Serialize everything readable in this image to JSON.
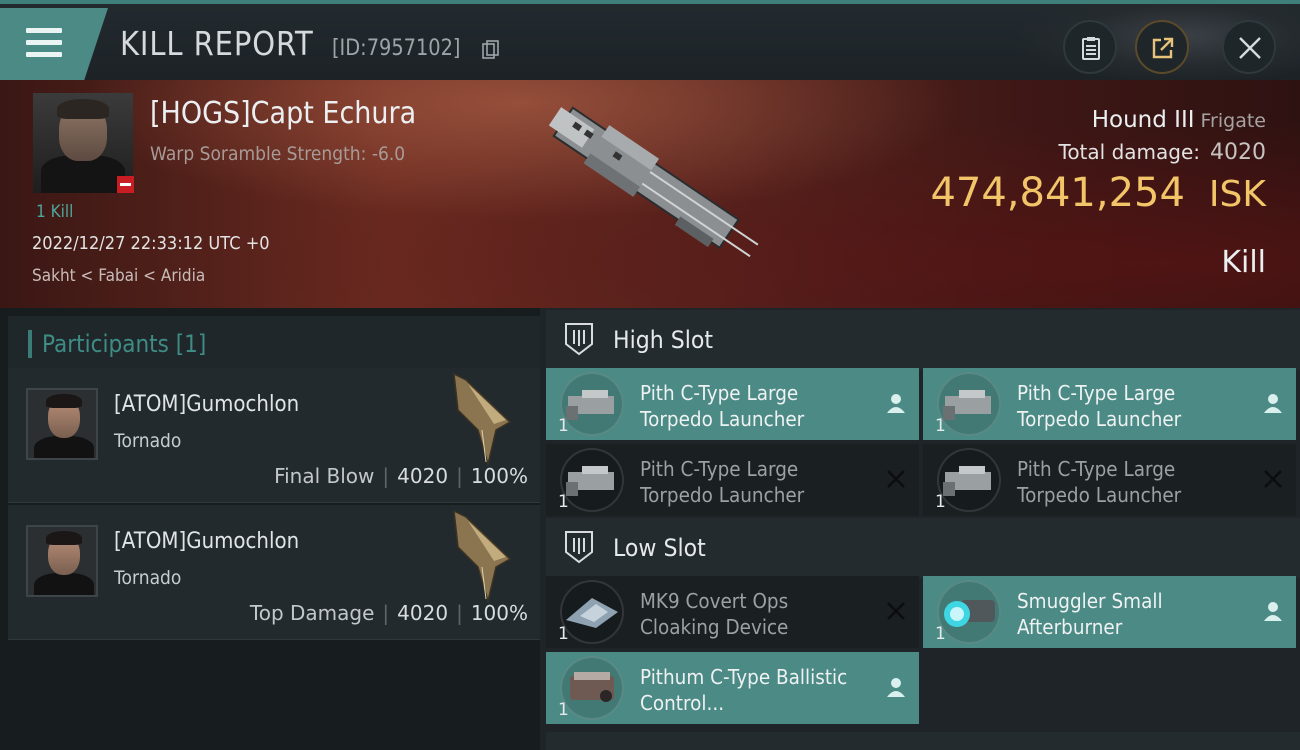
{
  "header": {
    "title": "KILL REPORT",
    "kill_id": "[ID:7957102]"
  },
  "victim": {
    "name": "[HOGS]Capt Echura",
    "subtitle": "Warp Soramble Strength: -6.0",
    "kill_count": "1 Kill",
    "date": "2022/12/27 22:33:12 UTC +0",
    "location": "Sakht < Fabai < Aridia",
    "ship_name": "Hound III",
    "ship_class": "Frigate",
    "total_damage_label": "Total damage:",
    "total_damage": "4020",
    "isk_value": "474,841,254",
    "isk_unit": "ISK",
    "result": "Kill"
  },
  "participants": {
    "heading": "Participants [1]",
    "rows": [
      {
        "name": "[ATOM]Gumochlon",
        "ship": "Tornado",
        "role": "Final Blow",
        "damage": "4020",
        "percent": "100%"
      },
      {
        "name": "[ATOM]Gumochlon",
        "ship": "Tornado",
        "role": "Top Damage",
        "damage": "4020",
        "percent": "100%"
      }
    ]
  },
  "slots": {
    "high": {
      "label": "High Slot",
      "modules": [
        {
          "qty": "1",
          "name": "Pith C-Type Large Torpedo Launcher",
          "status": "dropped"
        },
        {
          "qty": "1",
          "name": "Pith C-Type Large Torpedo Launcher",
          "status": "dropped"
        },
        {
          "qty": "1",
          "name": "Pith C-Type Large Torpedo Launcher",
          "status": "destroyed"
        },
        {
          "qty": "1",
          "name": "Pith C-Type Large Torpedo Launcher",
          "status": "destroyed"
        }
      ]
    },
    "low": {
      "label": "Low Slot",
      "modules": [
        {
          "qty": "1",
          "name": "MK9 Covert Ops Cloaking Device",
          "status": "destroyed"
        },
        {
          "qty": "1",
          "name": "Smuggler Small Afterburner",
          "status": "dropped"
        },
        {
          "qty": "1",
          "name": "Pithum C-Type Ballistic Control...",
          "status": "dropped"
        }
      ]
    }
  },
  "colors": {
    "accent": "#4c8a85",
    "isk": "#f2c569",
    "badge": "#c81d22"
  },
  "icons": [
    "menu-icon",
    "copy-icon",
    "clipboard-icon",
    "share-icon",
    "close-icon",
    "slot-icon",
    "pilot-icon",
    "destroyed-x-icon"
  ]
}
